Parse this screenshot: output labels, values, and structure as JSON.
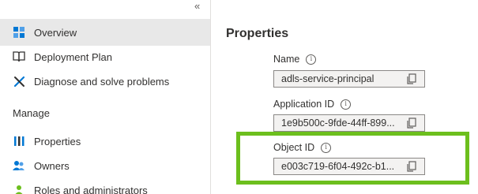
{
  "sidebar": {
    "collapse_glyph": "«",
    "items": [
      {
        "label": "Overview",
        "icon": "overview-icon",
        "active": true
      },
      {
        "label": "Deployment Plan",
        "icon": "book-icon"
      },
      {
        "label": "Diagnose and solve problems",
        "icon": "wrench-icon"
      }
    ],
    "section_header": "Manage",
    "manage_items": [
      {
        "label": "Properties",
        "icon": "properties-icon"
      },
      {
        "label": "Owners",
        "icon": "owners-icon"
      },
      {
        "label": "Roles and administrators",
        "icon": "roles-icon"
      }
    ]
  },
  "main": {
    "title": "Properties",
    "fields": [
      {
        "label": "Name",
        "value": "adls-service-principal"
      },
      {
        "label": "Application ID",
        "value": "1e9b500c-9fde-44ff-899..."
      },
      {
        "label": "Object ID",
        "value": "e003c719-6f04-492c-b1..."
      }
    ],
    "info_glyph": "i"
  },
  "colors": {
    "highlight": "#6cbf1d",
    "active_bg": "#e8e8e8",
    "field_bg": "#f3f2f1",
    "accent_blue": "#0078d4"
  }
}
